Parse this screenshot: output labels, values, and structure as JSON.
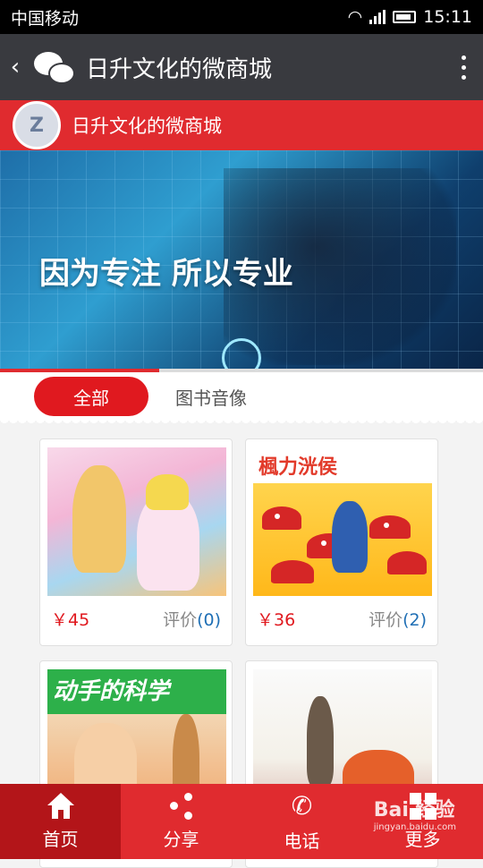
{
  "status_bar": {
    "carrier": "中国移动",
    "time": "15:11"
  },
  "app_bar": {
    "title": "日升文化的微商城",
    "back_icon": "back-chevron-icon",
    "menu_icon": "more-vertical-icon"
  },
  "shop_header": {
    "logo_text": "Z",
    "name": "日升文化的微商城"
  },
  "banner": {
    "slogan": "因为专注 所以专业",
    "slide_progress": 0.33
  },
  "tabs": [
    {
      "label": "全部",
      "active": true
    },
    {
      "label": "图书音像",
      "active": false
    }
  ],
  "products": [
    {
      "cover_title": "",
      "price": "￥45",
      "rating_label": "评价",
      "rating_count": "(0)"
    },
    {
      "cover_title": "楓力洸侯",
      "price": "￥36",
      "rating_label": "评价",
      "rating_count": "(2)"
    },
    {
      "cover_title": "动手的科学",
      "price": "",
      "rating_label": "",
      "rating_count": ""
    },
    {
      "cover_title": "",
      "price": "",
      "rating_label": "",
      "rating_count": ""
    }
  ],
  "bottom_nav": [
    {
      "label": "首页",
      "icon": "home-icon",
      "active": true
    },
    {
      "label": "分享",
      "icon": "share-icon",
      "active": false
    },
    {
      "label": "电话",
      "icon": "phone-icon",
      "active": false
    },
    {
      "label": "更多",
      "icon": "grid-icon",
      "active": false
    }
  ],
  "watermark": {
    "text": "Bai 经验",
    "sub": "jingyan.baidu.com"
  },
  "colors": {
    "brand_red": "#e02b2f",
    "appbar": "#393a3f",
    "price_red": "#e0191f",
    "rating_blue": "#1f6fb5"
  }
}
